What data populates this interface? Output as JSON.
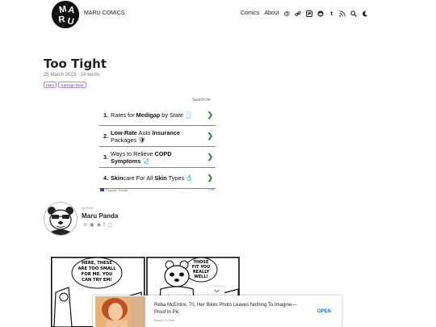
{
  "site": {
    "logo_text": "MARU",
    "title": "MARU COMICS",
    "nav": {
      "comics_label": "Comics",
      "about_label": "About",
      "icons": [
        "at-icon",
        "link-icon",
        "patreon-icon",
        "reddit-icon",
        "tumblr-icon",
        "rss-icon",
        "search-icon",
        "moon-icon"
      ]
    }
  },
  "post": {
    "title": "Too Tight",
    "date": "25 March 2023",
    "separator": "·",
    "words": "14 words",
    "tags": [
      "Maru",
      "Garbage Bear"
    ]
  },
  "ad": {
    "search_for": "Search for",
    "items": [
      {
        "num": "1.",
        "pre": "Rates for ",
        "b1": "Medigap",
        "mid": " by State ",
        "b2": "",
        "post": "",
        "emoji": "🧾"
      },
      {
        "num": "2.",
        "pre": "",
        "b1": "Low-Rate",
        "mid": " Auto ",
        "b2": "Insurance",
        "post": " Packages ",
        "emoji": "🛡"
      },
      {
        "num": "3.",
        "pre": "Ways to Relieve ",
        "b1": "COPD",
        "mid": " ",
        "b2": "Symptoms",
        "post": " ",
        "emoji": "🩺"
      },
      {
        "num": "4.",
        "pre": "",
        "b1": "Skin",
        "mid": "care For All ",
        "b2": "Skin",
        "post": " Types ",
        "emoji": "🧴"
      }
    ],
    "footer_source": "Popular Trends",
    "arrow": "❯"
  },
  "author": {
    "kicker": "AUTHOR",
    "name": "Maru Panda"
  },
  "comic": {
    "panel1_text": [
      "HERE, THESE",
      "ARE TOO SMALL",
      "FOR ME. YOU",
      "CAN TRY EM!"
    ],
    "panel2_text": [
      "THOSE",
      "FIT YOU",
      "REALLY",
      "WELL!"
    ]
  },
  "sticky_ad": {
    "toggle": "⌄",
    "title": "Reba McEntire, 70, Her Bikini Photo Leaves Nothing To Imagine—Proof In Pic",
    "source": "Bonus To Film",
    "cta": "OPEN"
  },
  "colors": {
    "accent_green": "#2e8b2e",
    "tag_purple": "#7a3fa0",
    "cta_blue": "#1a73c8"
  }
}
